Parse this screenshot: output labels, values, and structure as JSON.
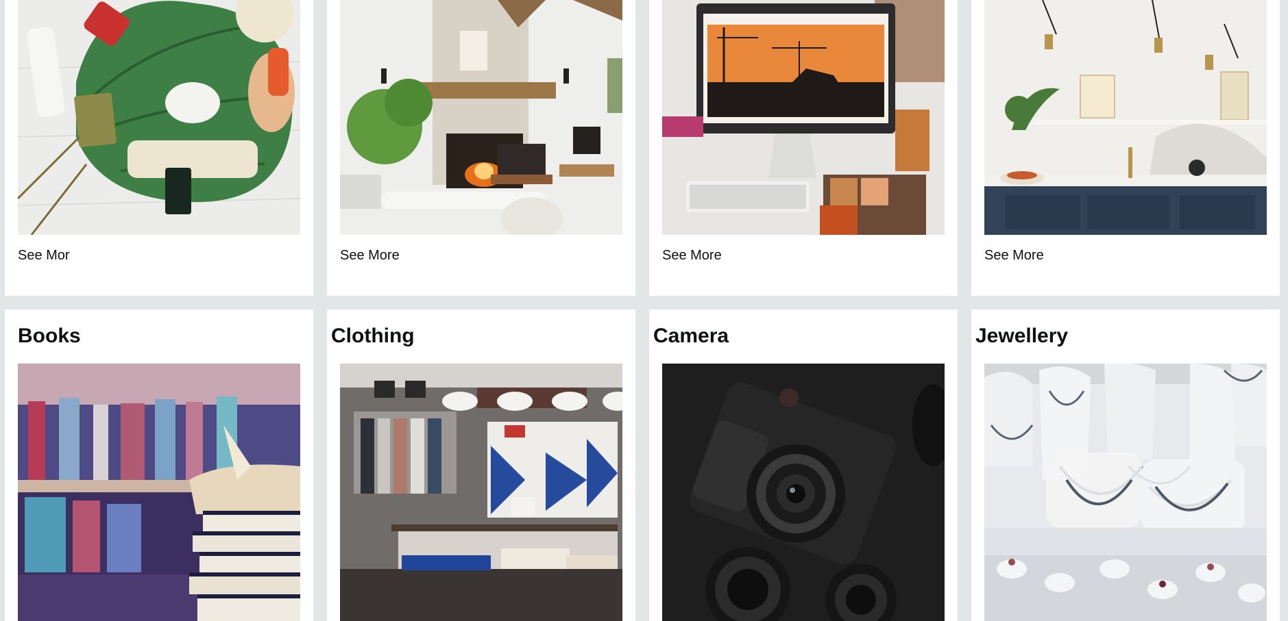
{
  "top_row": [
    {
      "link": "See Mor",
      "image": "beauty-products-image"
    },
    {
      "link": "See More",
      "image": "living-room-image"
    },
    {
      "link": "See More",
      "image": "computer-desk-image"
    },
    {
      "link": "See More",
      "image": "kitchen-image"
    }
  ],
  "bottom_row": [
    {
      "title": "Books",
      "image": "books-image"
    },
    {
      "title": "Clothing",
      "image": "clothing-store-image"
    },
    {
      "title": "Camera",
      "image": "camera-image"
    },
    {
      "title": "Jewellery",
      "image": "jewellery-display-image"
    }
  ]
}
